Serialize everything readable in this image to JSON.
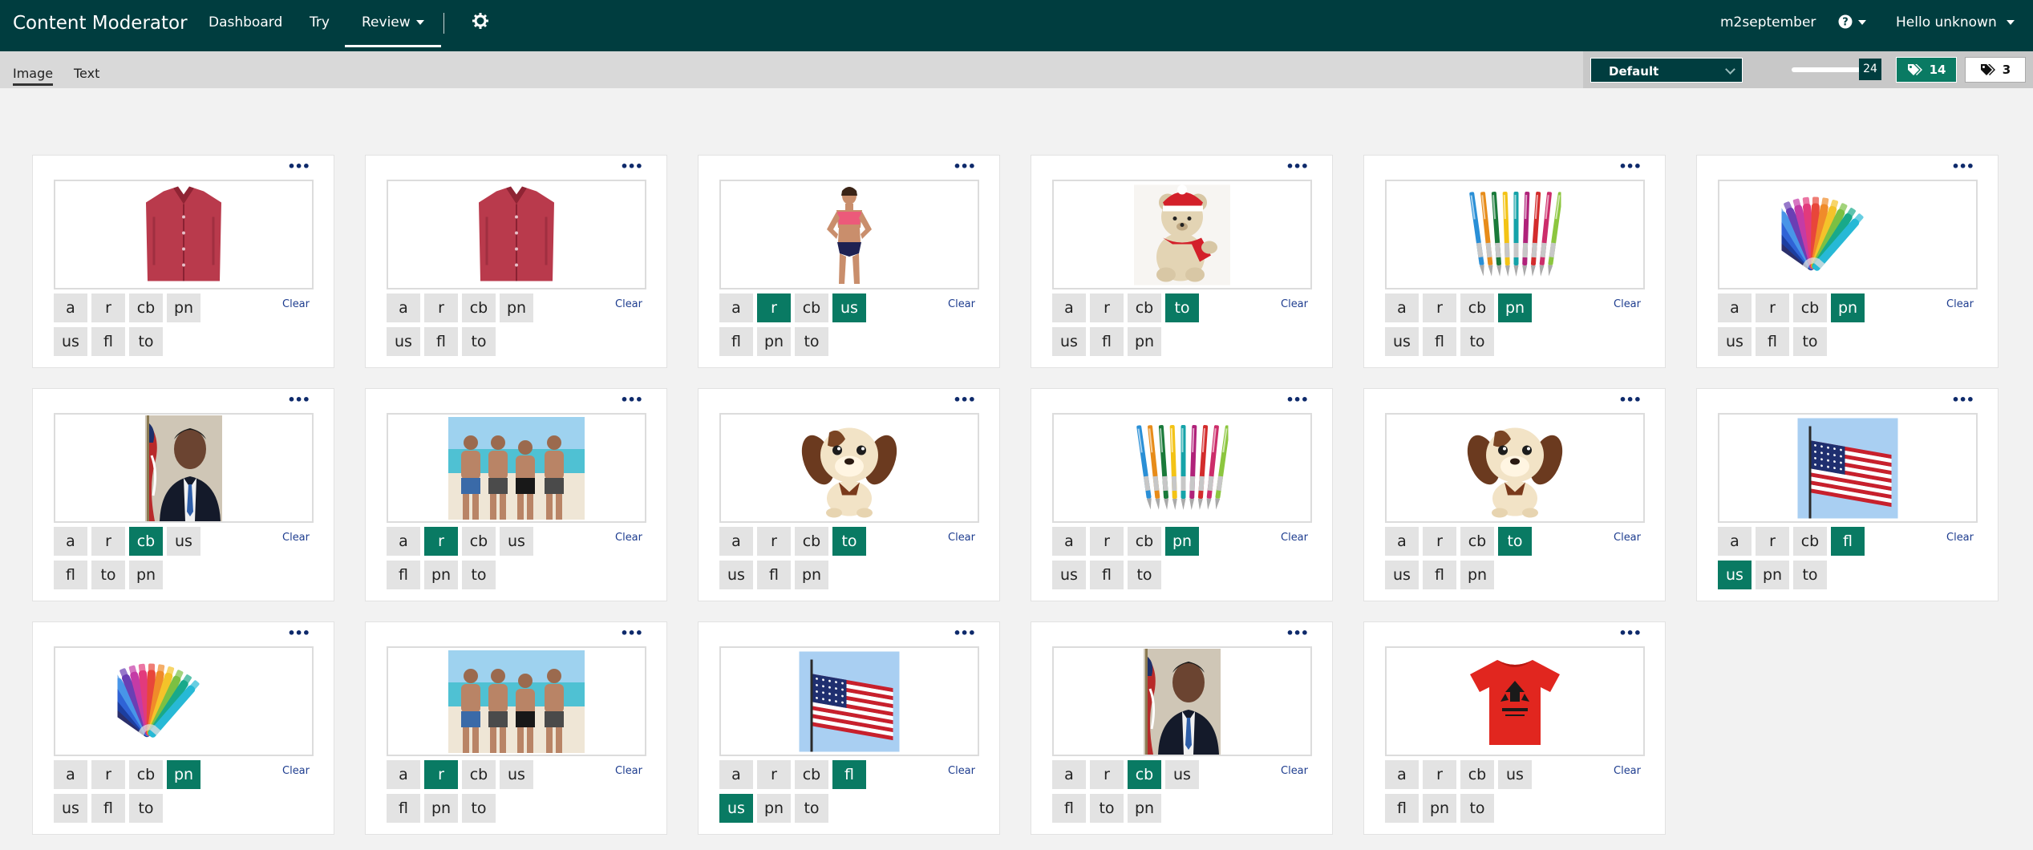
{
  "app": {
    "title": "Content Moderator"
  },
  "nav": {
    "dashboard": "Dashboard",
    "try": "Try",
    "review": "Review"
  },
  "user": {
    "team": "m2september",
    "greeting": "Hello unknown"
  },
  "subtabs": {
    "image": "Image",
    "text": "Text"
  },
  "toolbar": {
    "workflow": "Default",
    "page_size": "24",
    "tagged_count": "14",
    "untagged_count": "3"
  },
  "colors": {
    "nav_bg": "#003d3f",
    "tag_active": "#097a63",
    "tag_inactive": "#e3e3e3"
  },
  "card_labels": {
    "more": "•••",
    "clear": "Clear"
  },
  "cards": [
    {
      "image": "shirt",
      "tags": [
        [
          "a",
          false
        ],
        [
          "r",
          false
        ],
        [
          "cb",
          false
        ],
        [
          "pn",
          false
        ],
        [
          "us",
          false
        ],
        [
          "fl",
          false
        ],
        [
          "to",
          false
        ]
      ]
    },
    {
      "image": "shirt",
      "tags": [
        [
          "a",
          false
        ],
        [
          "r",
          false
        ],
        [
          "cb",
          false
        ],
        [
          "pn",
          false
        ],
        [
          "us",
          false
        ],
        [
          "fl",
          false
        ],
        [
          "to",
          false
        ]
      ]
    },
    {
      "image": "woman",
      "tags": [
        [
          "a",
          false
        ],
        [
          "r",
          true
        ],
        [
          "cb",
          false
        ],
        [
          "us",
          true
        ],
        [
          "fl",
          false
        ],
        [
          "pn",
          false
        ],
        [
          "to",
          false
        ]
      ]
    },
    {
      "image": "teddy-bear",
      "tags": [
        [
          "a",
          false
        ],
        [
          "r",
          false
        ],
        [
          "cb",
          false
        ],
        [
          "to",
          true
        ],
        [
          "us",
          false
        ],
        [
          "fl",
          false
        ],
        [
          "pn",
          false
        ]
      ]
    },
    {
      "image": "pens",
      "tags": [
        [
          "a",
          false
        ],
        [
          "r",
          false
        ],
        [
          "cb",
          false
        ],
        [
          "pn",
          true
        ],
        [
          "us",
          false
        ],
        [
          "fl",
          false
        ],
        [
          "to",
          false
        ]
      ]
    },
    {
      "image": "markers",
      "tags": [
        [
          "a",
          false
        ],
        [
          "r",
          false
        ],
        [
          "cb",
          false
        ],
        [
          "pn",
          true
        ],
        [
          "us",
          false
        ],
        [
          "fl",
          false
        ],
        [
          "to",
          false
        ]
      ]
    },
    {
      "image": "man-with-flag",
      "tags": [
        [
          "a",
          false
        ],
        [
          "r",
          false
        ],
        [
          "cb",
          true
        ],
        [
          "us",
          false
        ],
        [
          "fl",
          false
        ],
        [
          "to",
          false
        ],
        [
          "pn",
          false
        ]
      ]
    },
    {
      "image": "beach-group",
      "tags": [
        [
          "a",
          false
        ],
        [
          "r",
          true
        ],
        [
          "cb",
          false
        ],
        [
          "us",
          false
        ],
        [
          "fl",
          false
        ],
        [
          "pn",
          false
        ],
        [
          "to",
          false
        ]
      ]
    },
    {
      "image": "puppy",
      "tags": [
        [
          "a",
          false
        ],
        [
          "r",
          false
        ],
        [
          "cb",
          false
        ],
        [
          "to",
          true
        ],
        [
          "us",
          false
        ],
        [
          "fl",
          false
        ],
        [
          "pn",
          false
        ]
      ]
    },
    {
      "image": "pens",
      "tags": [
        [
          "a",
          false
        ],
        [
          "r",
          false
        ],
        [
          "cb",
          false
        ],
        [
          "pn",
          true
        ],
        [
          "us",
          false
        ],
        [
          "fl",
          false
        ],
        [
          "to",
          false
        ]
      ]
    },
    {
      "image": "puppy",
      "tags": [
        [
          "a",
          false
        ],
        [
          "r",
          false
        ],
        [
          "cb",
          false
        ],
        [
          "to",
          true
        ],
        [
          "us",
          false
        ],
        [
          "fl",
          false
        ],
        [
          "pn",
          false
        ]
      ]
    },
    {
      "image": "us-flag",
      "tags": [
        [
          "a",
          false
        ],
        [
          "r",
          false
        ],
        [
          "cb",
          false
        ],
        [
          "fl",
          true
        ],
        [
          "us",
          true
        ],
        [
          "pn",
          false
        ],
        [
          "to",
          false
        ]
      ]
    },
    {
      "image": "markers",
      "tags": [
        [
          "a",
          false
        ],
        [
          "r",
          false
        ],
        [
          "cb",
          false
        ],
        [
          "pn",
          true
        ],
        [
          "us",
          false
        ],
        [
          "fl",
          false
        ],
        [
          "to",
          false
        ]
      ]
    },
    {
      "image": "beach-group",
      "tags": [
        [
          "a",
          false
        ],
        [
          "r",
          true
        ],
        [
          "cb",
          false
        ],
        [
          "us",
          false
        ],
        [
          "fl",
          false
        ],
        [
          "pn",
          false
        ],
        [
          "to",
          false
        ]
      ]
    },
    {
      "image": "us-flag",
      "tags": [
        [
          "a",
          false
        ],
        [
          "r",
          false
        ],
        [
          "cb",
          false
        ],
        [
          "fl",
          true
        ],
        [
          "us",
          true
        ],
        [
          "pn",
          false
        ],
        [
          "to",
          false
        ]
      ]
    },
    {
      "image": "man-with-flag",
      "tags": [
        [
          "a",
          false
        ],
        [
          "r",
          false
        ],
        [
          "cb",
          true
        ],
        [
          "us",
          false
        ],
        [
          "fl",
          false
        ],
        [
          "to",
          false
        ],
        [
          "pn",
          false
        ]
      ]
    },
    {
      "image": "red-tshirt",
      "tags": [
        [
          "a",
          false
        ],
        [
          "r",
          false
        ],
        [
          "cb",
          false
        ],
        [
          "us",
          false
        ],
        [
          "fl",
          false
        ],
        [
          "pn",
          false
        ],
        [
          "to",
          false
        ]
      ]
    }
  ]
}
